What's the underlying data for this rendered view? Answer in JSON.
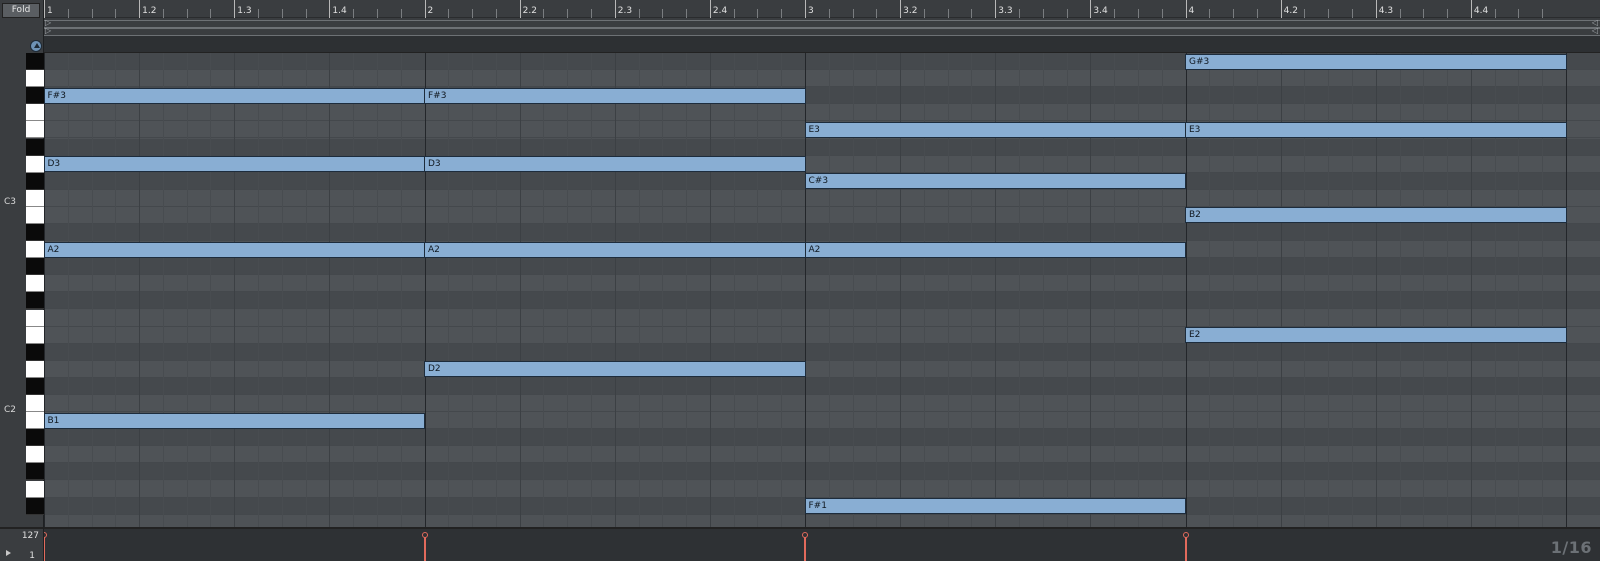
{
  "fold_button": {
    "label": "Fold"
  },
  "octave_labels": [
    "C3",
    "C2"
  ],
  "ruler": {
    "labels": [
      "1",
      "1.2",
      "1.3",
      "1.4",
      "2",
      "2.2",
      "2.3",
      "2.4",
      "3",
      "3.2",
      "3.3",
      "3.4",
      "4",
      "4.2",
      "4.3",
      "4.4"
    ]
  },
  "velocity": {
    "max_label": "127",
    "min_label": "1",
    "values": [
      127,
      127,
      127,
      127
    ]
  },
  "quantization": "1/16",
  "colors": {
    "note": "#89aed3",
    "velocity": "#e26a5c",
    "grid_light": "#4f5357",
    "grid_dark": "#45494d"
  },
  "pitch_range": {
    "top": "G#3",
    "bottom": "F#1"
  },
  "notes": [
    {
      "pitch": "F#3",
      "start": 1,
      "length": 1
    },
    {
      "pitch": "D3",
      "start": 1,
      "length": 1
    },
    {
      "pitch": "A2",
      "start": 1,
      "length": 1
    },
    {
      "pitch": "B1",
      "start": 1,
      "length": 1
    },
    {
      "pitch": "F#3",
      "start": 2,
      "length": 1
    },
    {
      "pitch": "D3",
      "start": 2,
      "length": 1
    },
    {
      "pitch": "A2",
      "start": 2,
      "length": 1
    },
    {
      "pitch": "D2",
      "start": 2,
      "length": 1
    },
    {
      "pitch": "E3",
      "start": 3,
      "length": 1
    },
    {
      "pitch": "C#3",
      "start": 3,
      "length": 1
    },
    {
      "pitch": "A2",
      "start": 3,
      "length": 1
    },
    {
      "pitch": "F#1",
      "start": 3,
      "length": 1
    },
    {
      "pitch": "G#3",
      "start": 4,
      "length": 1
    },
    {
      "pitch": "E3",
      "start": 4,
      "length": 1
    },
    {
      "pitch": "B2",
      "start": 4,
      "length": 1
    },
    {
      "pitch": "E2",
      "start": 4,
      "length": 1
    }
  ]
}
